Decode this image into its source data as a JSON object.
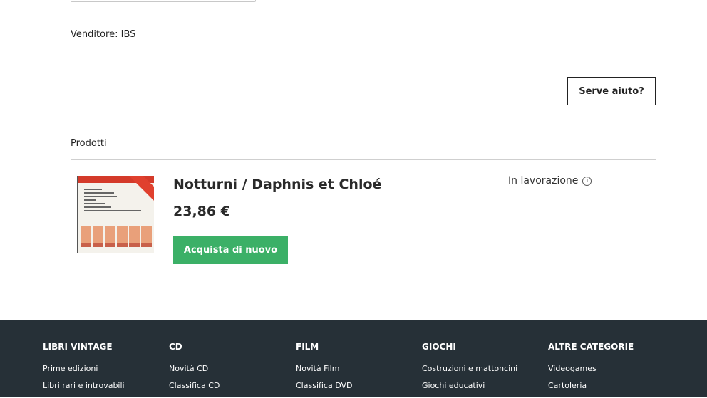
{
  "seller": {
    "text": "Venditore: IBS"
  },
  "help": {
    "label": "Serve aiuto?"
  },
  "products": {
    "heading": "Prodotti",
    "item": {
      "title": "Notturni / Daphnis et Chloé",
      "price": "23,86 €",
      "buy_again_label": "Acquista di nuovo",
      "status": "In lavorazione",
      "status_icon": "info-icon"
    }
  },
  "footer": {
    "columns": [
      {
        "title": "LIBRI VINTAGE",
        "links": [
          "Prime edizioni",
          "Libri rari e introvabili"
        ]
      },
      {
        "title": "CD",
        "links": [
          "Novità CD",
          "Classifica CD"
        ]
      },
      {
        "title": "FILM",
        "links": [
          "Novità Film",
          "Classifica DVD"
        ]
      },
      {
        "title": "GIOCHI",
        "links": [
          "Costruzioni e mattoncini",
          "Giochi educativi"
        ]
      },
      {
        "title": "ALTRE CATEGORIE",
        "links": [
          "Videogames",
          "Cartoleria"
        ]
      }
    ]
  },
  "colors": {
    "buy_button": "#3bb067",
    "footer_bg": "#263037"
  }
}
